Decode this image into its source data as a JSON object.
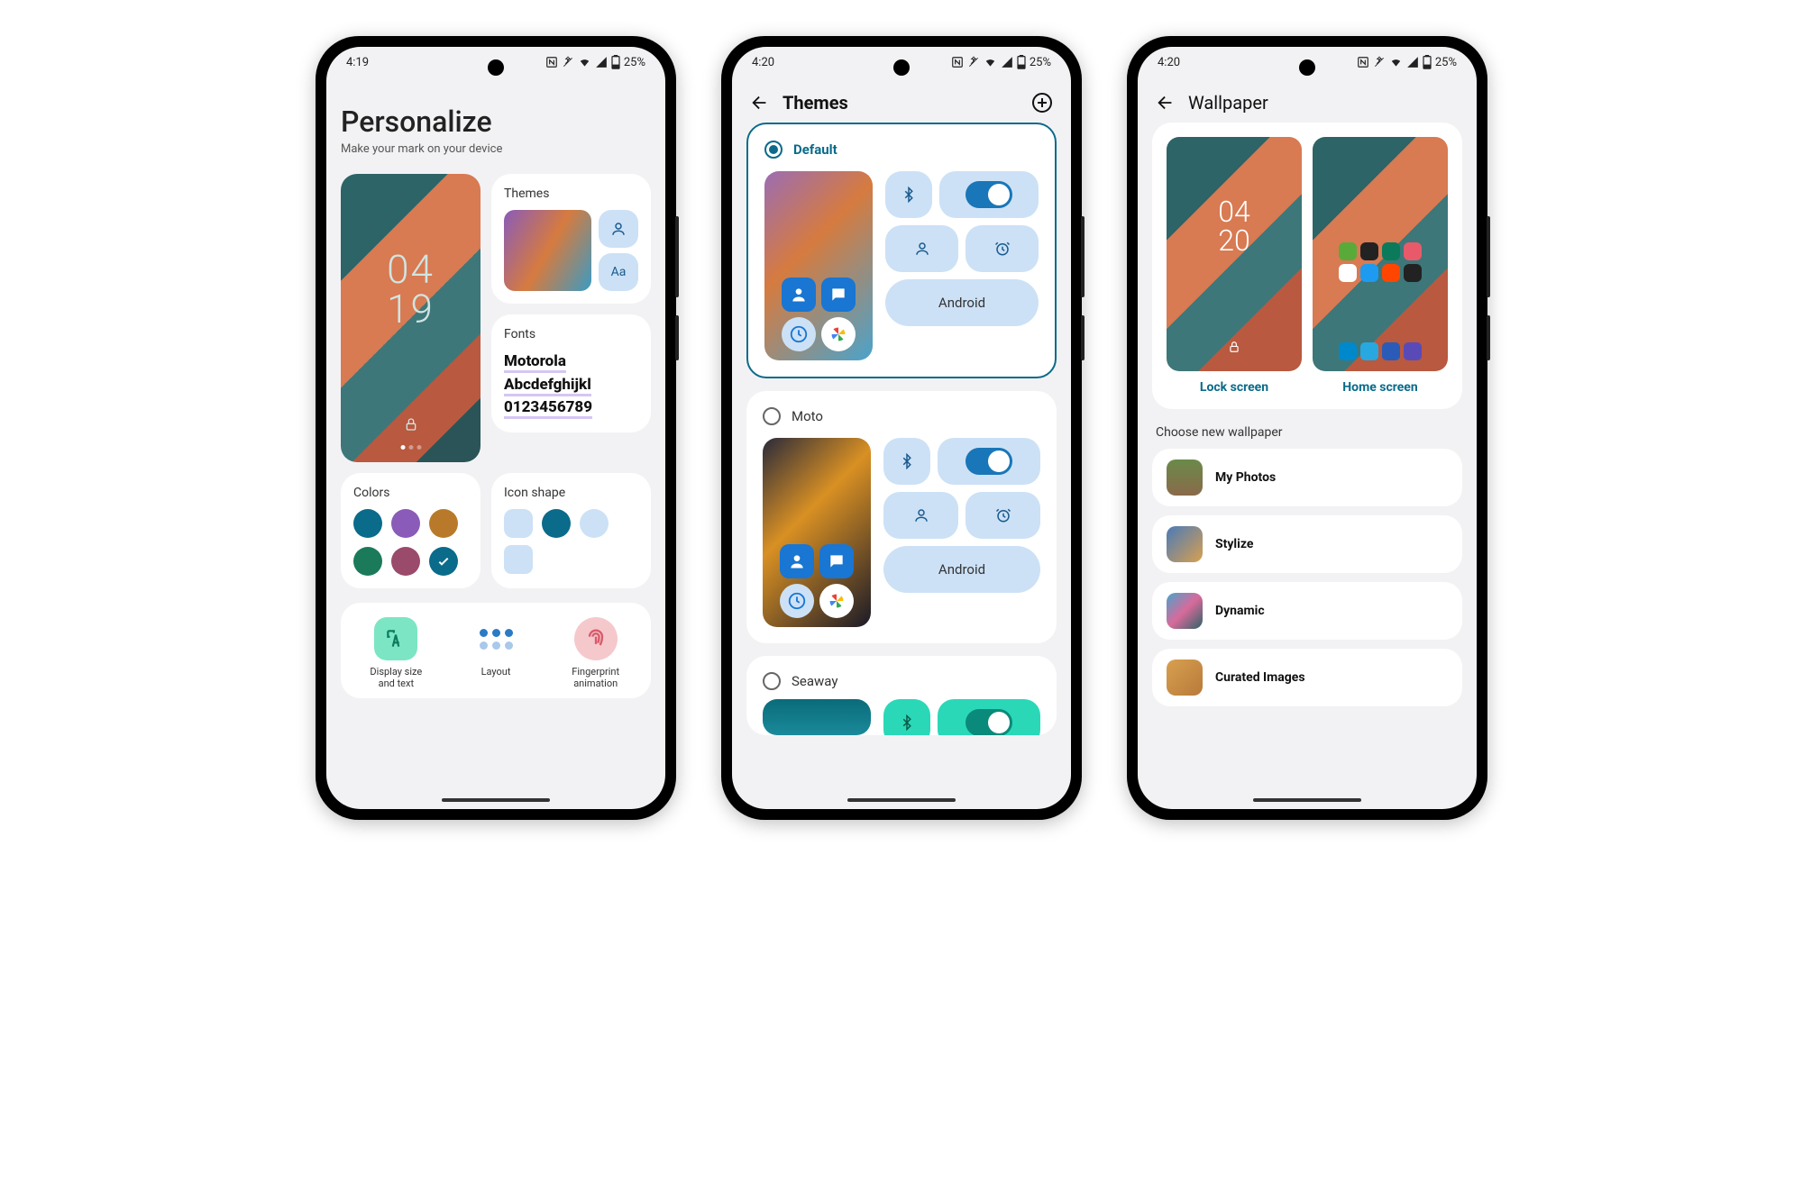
{
  "status": {
    "time1": "4:19",
    "time2": "4:20",
    "time3": "4:20",
    "battery": "25%"
  },
  "screen1": {
    "title": "Personalize",
    "subtitle": "Make your mark on your device",
    "clock_top": "04",
    "clock_bottom": "19",
    "themes_label": "Themes",
    "fonts_label": "Fonts",
    "fonts_sample1": "Motorola",
    "fonts_sample2": "Abcdefghijkl",
    "fonts_sample3": "0123456789",
    "colors_label": "Colors",
    "iconshape_label": "Icon shape",
    "bottom": {
      "display_size": "Display size\nand text",
      "layout": "Layout",
      "fingerprint": "Fingerprint\nanimation"
    },
    "colors": [
      "#0a6b8a",
      "#8a5bb8",
      "#b87a2a",
      "#1a7a5a",
      "#9a4a6a",
      "#0a6b8a"
    ],
    "theme_pill_aa": "Aa"
  },
  "screen2": {
    "title": "Themes",
    "themes": [
      {
        "name": "Default",
        "selected": true,
        "pill_label": "Android"
      },
      {
        "name": "Moto",
        "selected": false,
        "pill_label": "Android"
      },
      {
        "name": "Seaway",
        "selected": false
      }
    ]
  },
  "screen3": {
    "title": "Wallpaper",
    "clock_top": "04",
    "clock_bottom": "20",
    "tabs": {
      "lock": "Lock screen",
      "home": "Home screen"
    },
    "section": "Choose new wallpaper",
    "items": [
      {
        "label": "My Photos",
        "thumb_bg": "linear-gradient(#6a8a4a,#4a6a3a)"
      },
      {
        "label": "Stylize",
        "thumb_bg": "linear-gradient(135deg,#4a7ab8,#d8a050)"
      },
      {
        "label": "Dynamic",
        "thumb_bg": "linear-gradient(135deg,#4aa3cc,#d86a9a,#2d6467)"
      },
      {
        "label": "Curated Images",
        "thumb_bg": "linear-gradient(135deg,#d8a050,#b87a3a)"
      }
    ]
  }
}
